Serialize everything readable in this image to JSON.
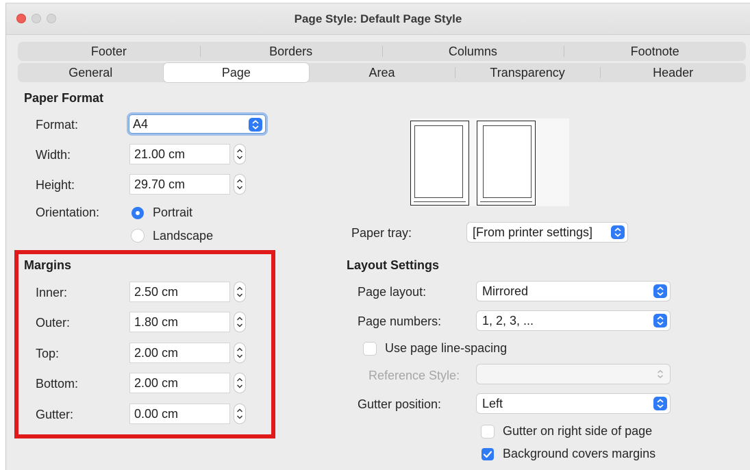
{
  "window": {
    "title": "Page Style: Default Page Style"
  },
  "tabs": {
    "row1": [
      "Footer",
      "Borders",
      "Columns",
      "Footnote"
    ],
    "row2": [
      "General",
      "Page",
      "Area",
      "Transparency",
      "Header"
    ],
    "active": "Page"
  },
  "paper_format": {
    "heading": "Paper Format",
    "format_label": "Format:",
    "format_value": "A4",
    "width_label": "Width:",
    "width_value": "21.00 cm",
    "height_label": "Height:",
    "height_value": "29.70 cm",
    "orientation_label": "Orientation:",
    "portrait_label": "Portrait",
    "landscape_label": "Landscape",
    "orientation_selected": "Portrait"
  },
  "paper_tray": {
    "label": "Paper tray:",
    "value": "[From printer settings]"
  },
  "margins": {
    "heading": "Margins",
    "inner_label": "Inner:",
    "inner_value": "2.50 cm",
    "outer_label": "Outer:",
    "outer_value": "1.80 cm",
    "top_label": "Top:",
    "top_value": "2.00 cm",
    "bottom_label": "Bottom:",
    "bottom_value": "2.00 cm",
    "gutter_label": "Gutter:",
    "gutter_value": "0.00 cm",
    "highlight_color": "#e01a1a"
  },
  "layout": {
    "heading": "Layout Settings",
    "page_layout_label": "Page layout:",
    "page_layout_value": "Mirrored",
    "page_numbers_label": "Page numbers:",
    "page_numbers_value": "1, 2, 3, ...",
    "use_line_spacing_label": "Use page line-spacing",
    "use_line_spacing_checked": false,
    "reference_style_label": "Reference Style:",
    "reference_style_value": "",
    "gutter_position_label": "Gutter position:",
    "gutter_position_value": "Left",
    "gutter_right_label": "Gutter on right side of page",
    "gutter_right_checked": false,
    "bg_covers_label": "Background covers margins",
    "bg_covers_checked": true
  },
  "colors": {
    "accent": "#2f7bf5",
    "close": "#ee5f57"
  }
}
